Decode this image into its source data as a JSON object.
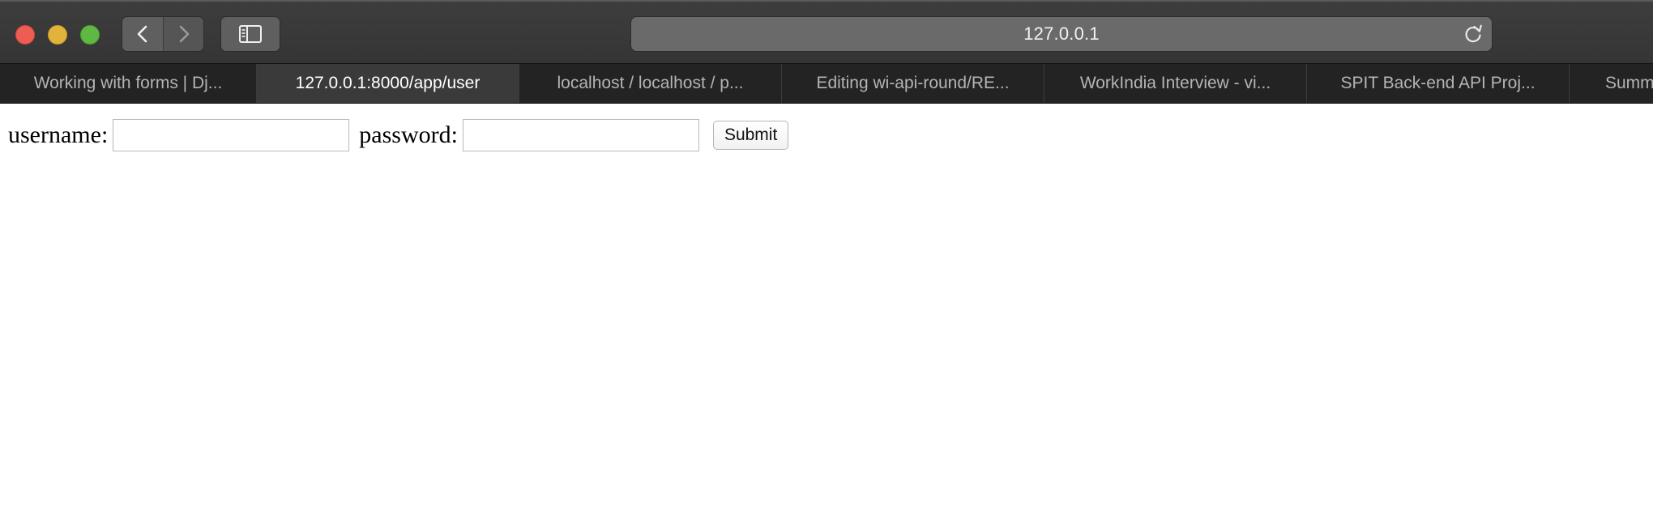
{
  "browser": {
    "address": "127.0.0.1",
    "tabs": [
      {
        "label": "Working with forms | Dj...",
        "active": false
      },
      {
        "label": "127.0.0.1:8000/app/user",
        "active": true
      },
      {
        "label": "localhost / localhost / p...",
        "active": false
      },
      {
        "label": "Editing wi-api-round/RE...",
        "active": false
      },
      {
        "label": "WorkIndia Interview - vi...",
        "active": false
      },
      {
        "label": "SPIT Back-end API Proj...",
        "active": false
      },
      {
        "label": "Summ",
        "active": false
      }
    ],
    "icons": {
      "back": "chevron-left-icon",
      "forward": "chevron-right-icon",
      "sidebar": "sidebar-icon",
      "reload": "reload-icon"
    },
    "colors": {
      "close": "#ee5d52",
      "minimize": "#e0b33b",
      "zoom": "#5fb843"
    }
  },
  "form": {
    "username_label": "username:",
    "username_value": "",
    "password_label": "password:",
    "password_value": "",
    "submit_label": "Submit"
  }
}
